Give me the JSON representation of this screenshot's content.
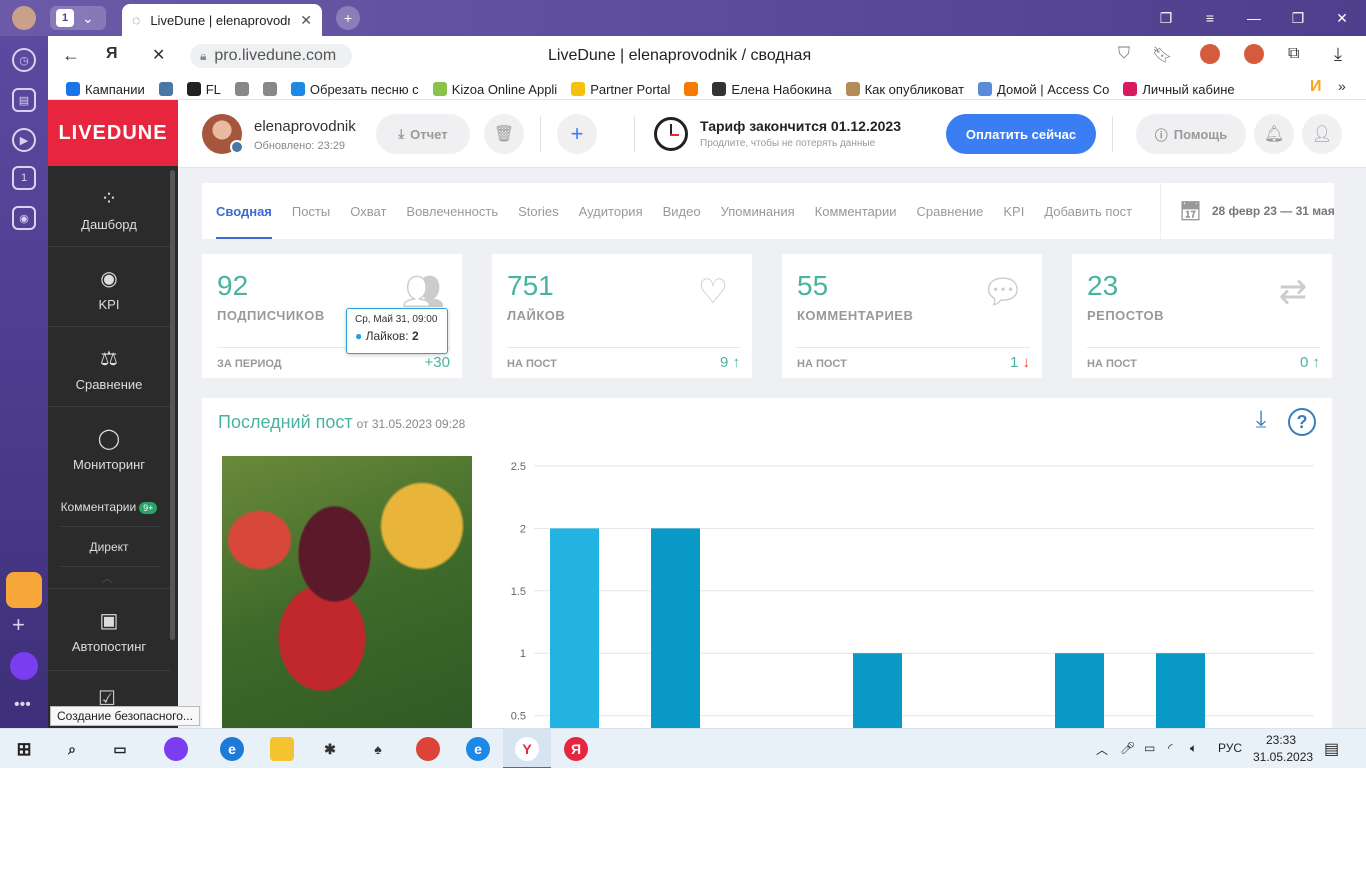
{
  "browser": {
    "tab_title": "LiveDune | elenaprovodnik",
    "tab_count": "1",
    "address": "pro.livedune.com",
    "page_title": "LiveDune | elenaprovodnik / сводная",
    "bookmarks": [
      {
        "label": "Кампании",
        "color": "#1a73e8"
      },
      {
        "label": "",
        "color": "#4a76a8"
      },
      {
        "label": "FL",
        "color": "#222"
      },
      {
        "label": "",
        "color": "#888"
      },
      {
        "label": "",
        "color": "#888"
      },
      {
        "label": "Обрезать песню с",
        "color": "#1e88e5"
      },
      {
        "label": "Kizoa Online Appli",
        "color": "#8bc34a"
      },
      {
        "label": "Partner Portal",
        "color": "#f4c20d"
      },
      {
        "label": "",
        "color": "#f57c00"
      },
      {
        "label": "Елена Набокина",
        "color": "#333"
      },
      {
        "label": "Как опубликоват",
        "color": "#b58b5a"
      },
      {
        "label": "Домой | Access Co",
        "color": "#5a8ad8"
      },
      {
        "label": "Личный кабине",
        "color": "#d81b60"
      }
    ]
  },
  "app": {
    "logo": "LIVEDUNE",
    "side": {
      "dashboard": "Дашборд",
      "kpi": "KPI",
      "compare": "Сравнение",
      "monitoring": "Мониторинг",
      "comments": "Комментарии",
      "comments_badge": "9+",
      "direct": "Директ",
      "autoposting": "Автопостинг"
    },
    "header": {
      "username": "elenaprovodnik",
      "updated": "Обновлено: 23:29",
      "report": "Отчет",
      "tariff_title": "Тариф закончится 01.12.2023",
      "tariff_sub": "Продлите, чтобы не потерять данные",
      "pay": "Оплатить сейчас",
      "help": "Помощь"
    },
    "tabs": [
      "Сводная",
      "Посты",
      "Охват",
      "Вовлеченность",
      "Stories",
      "Аудитория",
      "Видео",
      "Упоминания",
      "Комментарии",
      "Сравнение",
      "KPI",
      "Добавить пост"
    ],
    "date_range": "28 февр 23 — 31 мая",
    "stats": [
      {
        "num": "92",
        "label": "ПОДПИСЧИКОВ",
        "sub": "ЗА ПЕРИОД",
        "val": "+30",
        "arrow": "",
        "icon": "users-icon"
      },
      {
        "num": "751",
        "label": "ЛАЙКОВ",
        "sub": "НА ПОСТ",
        "val": "9",
        "arrow": "↑",
        "icon": "heart-icon"
      },
      {
        "num": "55",
        "label": "КОММЕНТАРИЕВ",
        "sub": "НА ПОСТ",
        "val": "1",
        "arrow": "↓",
        "icon": "chat-icon"
      },
      {
        "num": "23",
        "label": "РЕПОСТОВ",
        "sub": "НА ПОСТ",
        "val": "0",
        "arrow": "↑",
        "icon": "repost-icon"
      }
    ],
    "post": {
      "title": "Последний пост",
      "date": "от 31.05.2023 09:28"
    },
    "tooltip": {
      "line1": "Ср, Май 31, 09:00",
      "label": "Лайков:",
      "value": "2"
    }
  },
  "chart_data": {
    "type": "bar",
    "y_ticks": [
      "2.5",
      "2",
      "1.5",
      "1",
      "0.5"
    ],
    "ylim": [
      0,
      2.5
    ],
    "values": [
      2,
      2,
      0,
      1,
      0,
      1,
      1,
      0
    ],
    "highlight_index": 0
  },
  "taskbar": {
    "lang": "РУС",
    "time": "23:33",
    "date": "31.05.2023"
  },
  "status_tooltip": "Создание безопасного..."
}
